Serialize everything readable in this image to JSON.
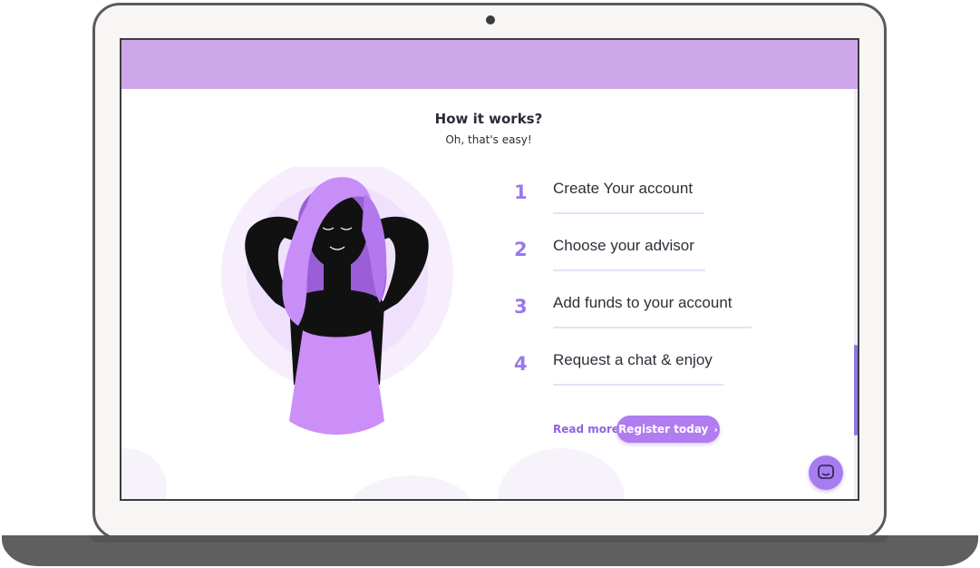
{
  "section": {
    "title": "How it works?",
    "subtitle": "Oh, that's easy!"
  },
  "steps": [
    {
      "number": "1",
      "label": "Create Your account"
    },
    {
      "number": "2",
      "label": "Choose your advisor"
    },
    {
      "number": "3",
      "label": "Add funds to your account"
    },
    {
      "number": "4",
      "label": "Request a chat & enjoy"
    }
  ],
  "actions": {
    "read_more": "Read more",
    "register": "Register today",
    "register_chevron": "›"
  },
  "icons": {
    "chat": "chat-bubble-icon",
    "camera": "camera-dot"
  },
  "colors": {
    "header": "#cda6ea",
    "accent": "#9a78ea",
    "button": "#b07cf0"
  }
}
